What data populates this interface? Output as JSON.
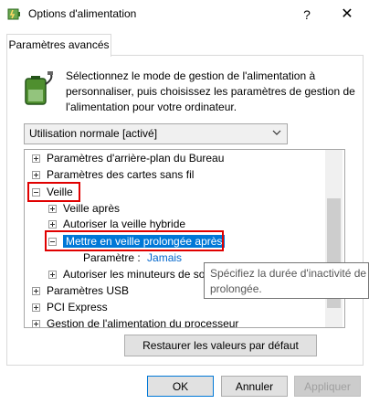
{
  "window": {
    "title": "Options d'alimentation",
    "help_symbol": "?",
    "close_symbol": "✕"
  },
  "tab": {
    "label": "Paramètres avancés"
  },
  "description": "Sélectionnez le mode de gestion de l'alimentation à personnaliser, puis choisissez les paramètres de gestion de l'alimentation pour votre ordinateur.",
  "plan_dropdown": {
    "selected": "Utilisation normale [activé]"
  },
  "tree": {
    "items": [
      {
        "label": "Paramètres d'arrière-plan du Bureau",
        "state": "collapsed"
      },
      {
        "label": "Paramètres des cartes sans fil",
        "state": "collapsed"
      },
      {
        "label": "Veille",
        "state": "expanded"
      },
      {
        "label": "Veille après",
        "state": "collapsed"
      },
      {
        "label": "Autoriser la veille hybride",
        "state": "collapsed"
      },
      {
        "label": "Mettre en veille prolongée après",
        "state": "expanded"
      },
      {
        "label": "Paramètre :",
        "value": "Jamais"
      },
      {
        "label": "Autoriser les minuteurs de so",
        "state": "collapsed"
      },
      {
        "label": "Paramètres USB",
        "state": "collapsed"
      },
      {
        "label": "PCI Express",
        "state": "collapsed"
      },
      {
        "label": "Gestion de l'alimentation du processeur",
        "state": "collapsed"
      }
    ]
  },
  "tooltip": {
    "line1": "Spécifiez la durée d'inactivité de l'",
    "line2": "prolongée."
  },
  "buttons": {
    "restore": "Restaurer les valeurs par défaut",
    "ok": "OK",
    "cancel": "Annuler",
    "apply": "Appliquer"
  },
  "colors": {
    "selection": "#0078d7",
    "highlight_box": "#e00000",
    "link": "#0066cc"
  }
}
